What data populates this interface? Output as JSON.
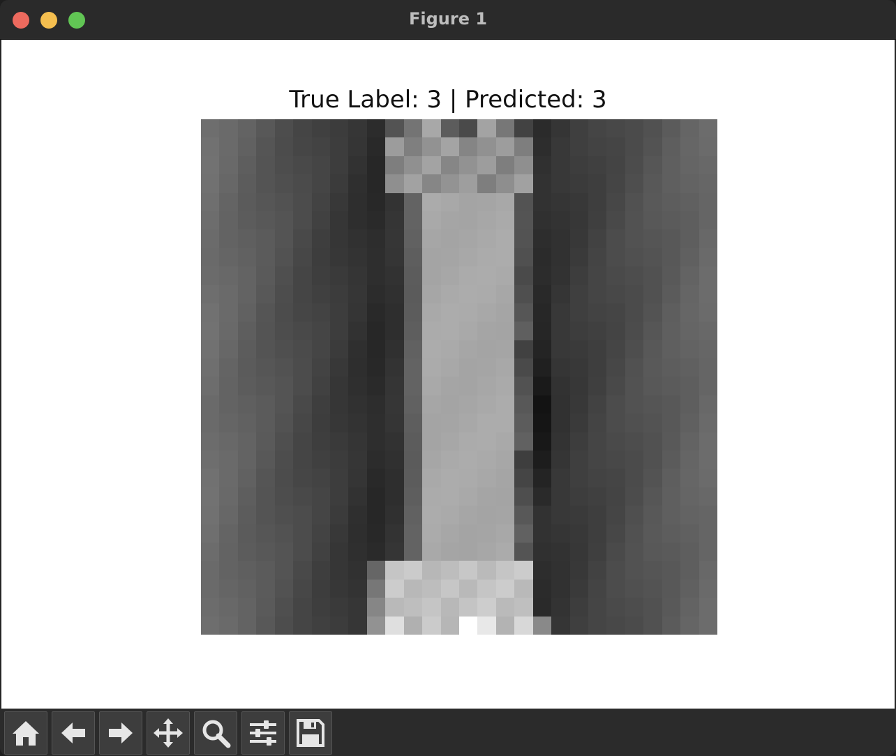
{
  "window": {
    "title": "Figure 1"
  },
  "figure": {
    "title": "True Label: 3 | Predicted: 3",
    "image": {
      "colormap": "gray",
      "rows": 28,
      "cols": 28,
      "true_label": 3,
      "predicted_label": 3
    }
  },
  "toolbar": {
    "buttons": [
      {
        "name": "home-icon",
        "tooltip": "Home"
      },
      {
        "name": "back-arrow-icon",
        "tooltip": "Back"
      },
      {
        "name": "forward-arrow-icon",
        "tooltip": "Forward"
      },
      {
        "name": "pan-move-icon",
        "tooltip": "Pan"
      },
      {
        "name": "zoom-magnifier-icon",
        "tooltip": "Zoom"
      },
      {
        "name": "configure-sliders-icon",
        "tooltip": "Configure subplots"
      },
      {
        "name": "save-disk-icon",
        "tooltip": "Save"
      }
    ]
  },
  "colors": {
    "titlebar": "#2a2a2a",
    "canvas": "#ffffff",
    "toolbar": "#2b2b2b",
    "close": "#ed6a5e",
    "minimize": "#f5bf4f",
    "maximize": "#61c554"
  }
}
